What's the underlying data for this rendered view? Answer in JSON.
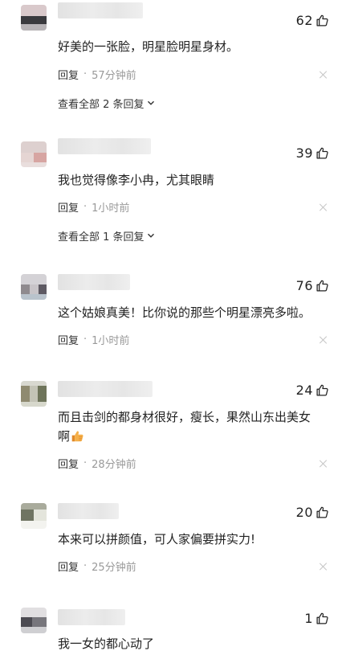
{
  "colors": {
    "text": "#222222",
    "meta": "#999999",
    "reply": "#333333",
    "close": "#c6c6c6",
    "emoji_thumb": "#f0a436"
  },
  "comments": [
    {
      "likes": "62",
      "text": "好美的一张脸，明星脸明星身材。",
      "reply_label": "回复",
      "separator": "·",
      "time": "57分钟前",
      "view_all": "查看全部 2 条回复"
    },
    {
      "likes": "39",
      "text": "我也觉得像李小冉，尤其眼睛",
      "reply_label": "回复",
      "separator": "·",
      "time": "1小时前",
      "view_all": "查看全部 1 条回复"
    },
    {
      "likes": "76",
      "text": "这个姑娘真美！比你说的那些个明星漂亮多啦。",
      "reply_label": "回复",
      "separator": "·",
      "time": "1小时前"
    },
    {
      "likes": "24",
      "text_line1": "而且击剑的都身材很好，瘦长，果然山东出美女",
      "text_line2": "啊",
      "emoji": "thumbs-up-emoji",
      "reply_label": "回复",
      "separator": "·",
      "time": "28分钟前"
    },
    {
      "likes": "20",
      "text": "本来可以拼颜值，可人家偏要拼实力!",
      "reply_label": "回复",
      "separator": "·",
      "time": "25分钟前"
    },
    {
      "likes": "1",
      "text": "我一女的都心动了"
    }
  ],
  "icons": {
    "like": "thumbs-up-outline-icon",
    "close": "close-icon",
    "expand": "chevron-down-icon"
  }
}
